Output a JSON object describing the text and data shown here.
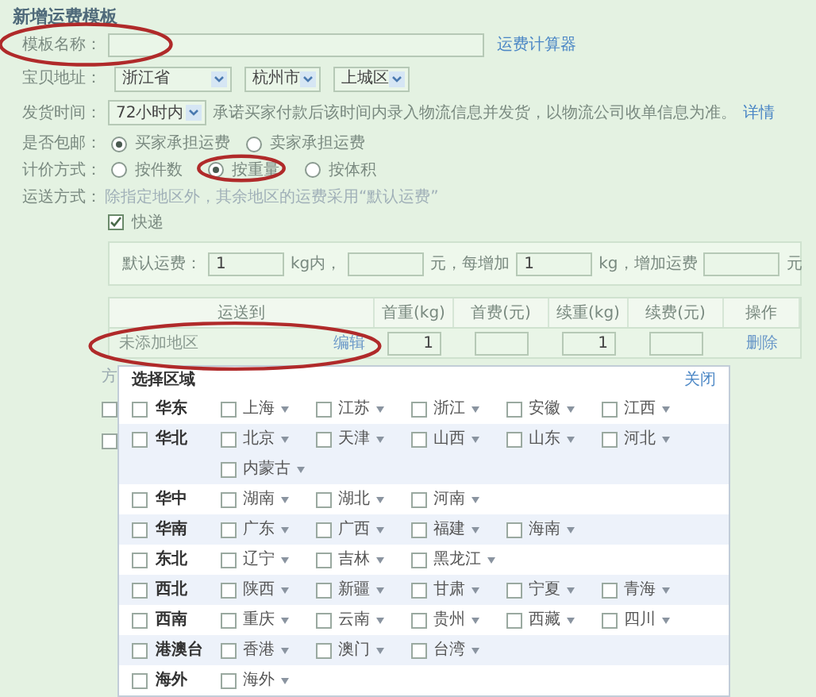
{
  "title": "新增运费模板",
  "name_field": {
    "label": "模板名称：",
    "link": "运费计算器"
  },
  "address": {
    "label": "宝贝地址：",
    "selects": [
      "浙江省",
      "杭州市",
      "上城区"
    ]
  },
  "ship_time": {
    "label": "发货时间：",
    "select": "72小时内",
    "note": "承诺买家付款后该时间内录入物流信息并发货，以物流公司收单信息为准。",
    "link": "详情"
  },
  "free_shipping": {
    "label": "是否包邮：",
    "options": [
      {
        "label": "买家承担运费",
        "selected": true
      },
      {
        "label": "卖家承担运费",
        "selected": false
      }
    ]
  },
  "pricing": {
    "label": "计价方式：",
    "options": [
      {
        "label": "按件数",
        "selected": false
      },
      {
        "label": "按重量",
        "selected": true
      },
      {
        "label": "按体积",
        "selected": false
      }
    ]
  },
  "delivery": {
    "label": "运送方式：",
    "note": "除指定地区外，其余地区的运费采用“默认运费”",
    "methods": [
      {
        "label": "快递",
        "checked": true
      }
    ]
  },
  "default_fee": [
    {
      "kind": "text",
      "text": "默认运费："
    },
    {
      "kind": "input",
      "value": "1"
    },
    {
      "kind": "text",
      "text": "kg内，"
    },
    {
      "kind": "input"
    },
    {
      "kind": "text",
      "text": "元，每增加"
    },
    {
      "kind": "input",
      "value": "1"
    },
    {
      "kind": "text",
      "text": "kg，增加运费"
    },
    {
      "kind": "input"
    },
    {
      "kind": "text",
      "text": "元"
    }
  ],
  "table": {
    "columns": [
      "运送到",
      "首重(kg)",
      "首费(元)",
      "续重(kg)",
      "续费(元)",
      "操作"
    ],
    "rows": [
      {
        "region": "未添加地区",
        "edit": "编辑",
        "inputs": [
          {
            "kind": "filled",
            "value": "1"
          },
          {
            "kind": "blank"
          },
          {
            "kind": "filled",
            "value": "1"
          },
          {
            "kind": "blank"
          }
        ],
        "action": "删除"
      }
    ]
  },
  "behind": {
    "text": "方",
    "checkboxes": [
      {
        "checked": false
      },
      {
        "checked": false
      }
    ]
  },
  "region_popup": {
    "title": "选择区域",
    "close": "关闭",
    "groups": [
      {
        "name": "华东",
        "checked": false,
        "provinces": [
          {
            "name": "上海",
            "checked": false
          },
          {
            "name": "江苏",
            "checked": false
          },
          {
            "name": "浙江",
            "checked": false
          },
          {
            "name": "安徽",
            "checked": false
          },
          {
            "name": "江西",
            "checked": false
          }
        ]
      },
      {
        "name": "华北",
        "checked": false,
        "provinces": [
          {
            "name": "北京",
            "checked": false
          },
          {
            "name": "天津",
            "checked": false
          },
          {
            "name": "山西",
            "checked": false
          },
          {
            "name": "山东",
            "checked": false
          },
          {
            "name": "河北",
            "checked": false
          },
          {
            "name": "内蒙古",
            "checked": false
          }
        ]
      },
      {
        "name": "华中",
        "checked": false,
        "provinces": [
          {
            "name": "湖南",
            "checked": false
          },
          {
            "name": "湖北",
            "checked": false
          },
          {
            "name": "河南",
            "checked": false
          }
        ]
      },
      {
        "name": "华南",
        "checked": false,
        "provinces": [
          {
            "name": "广东",
            "checked": false
          },
          {
            "name": "广西",
            "checked": false
          },
          {
            "name": "福建",
            "checked": false
          },
          {
            "name": "海南",
            "checked": false
          }
        ]
      },
      {
        "name": "东北",
        "checked": false,
        "provinces": [
          {
            "name": "辽宁",
            "checked": false
          },
          {
            "name": "吉林",
            "checked": false
          },
          {
            "name": "黑龙江",
            "checked": false
          }
        ]
      },
      {
        "name": "西北",
        "checked": false,
        "provinces": [
          {
            "name": "陕西",
            "checked": false
          },
          {
            "name": "新疆",
            "checked": false
          },
          {
            "name": "甘肃",
            "checked": false
          },
          {
            "name": "宁夏",
            "checked": false
          },
          {
            "name": "青海",
            "checked": false
          }
        ]
      },
      {
        "name": "西南",
        "checked": false,
        "provinces": [
          {
            "name": "重庆",
            "checked": false
          },
          {
            "name": "云南",
            "checked": false
          },
          {
            "name": "贵州",
            "checked": false
          },
          {
            "name": "西藏",
            "checked": false
          },
          {
            "name": "四川",
            "checked": false
          }
        ]
      },
      {
        "name": "港澳台",
        "checked": false,
        "provinces": [
          {
            "name": "香港",
            "checked": false
          },
          {
            "name": "澳门",
            "checked": false
          },
          {
            "name": "台湾",
            "checked": false
          }
        ]
      },
      {
        "name": "海外",
        "checked": false,
        "provinces": [
          {
            "name": "海外",
            "checked": false
          }
        ]
      }
    ]
  }
}
